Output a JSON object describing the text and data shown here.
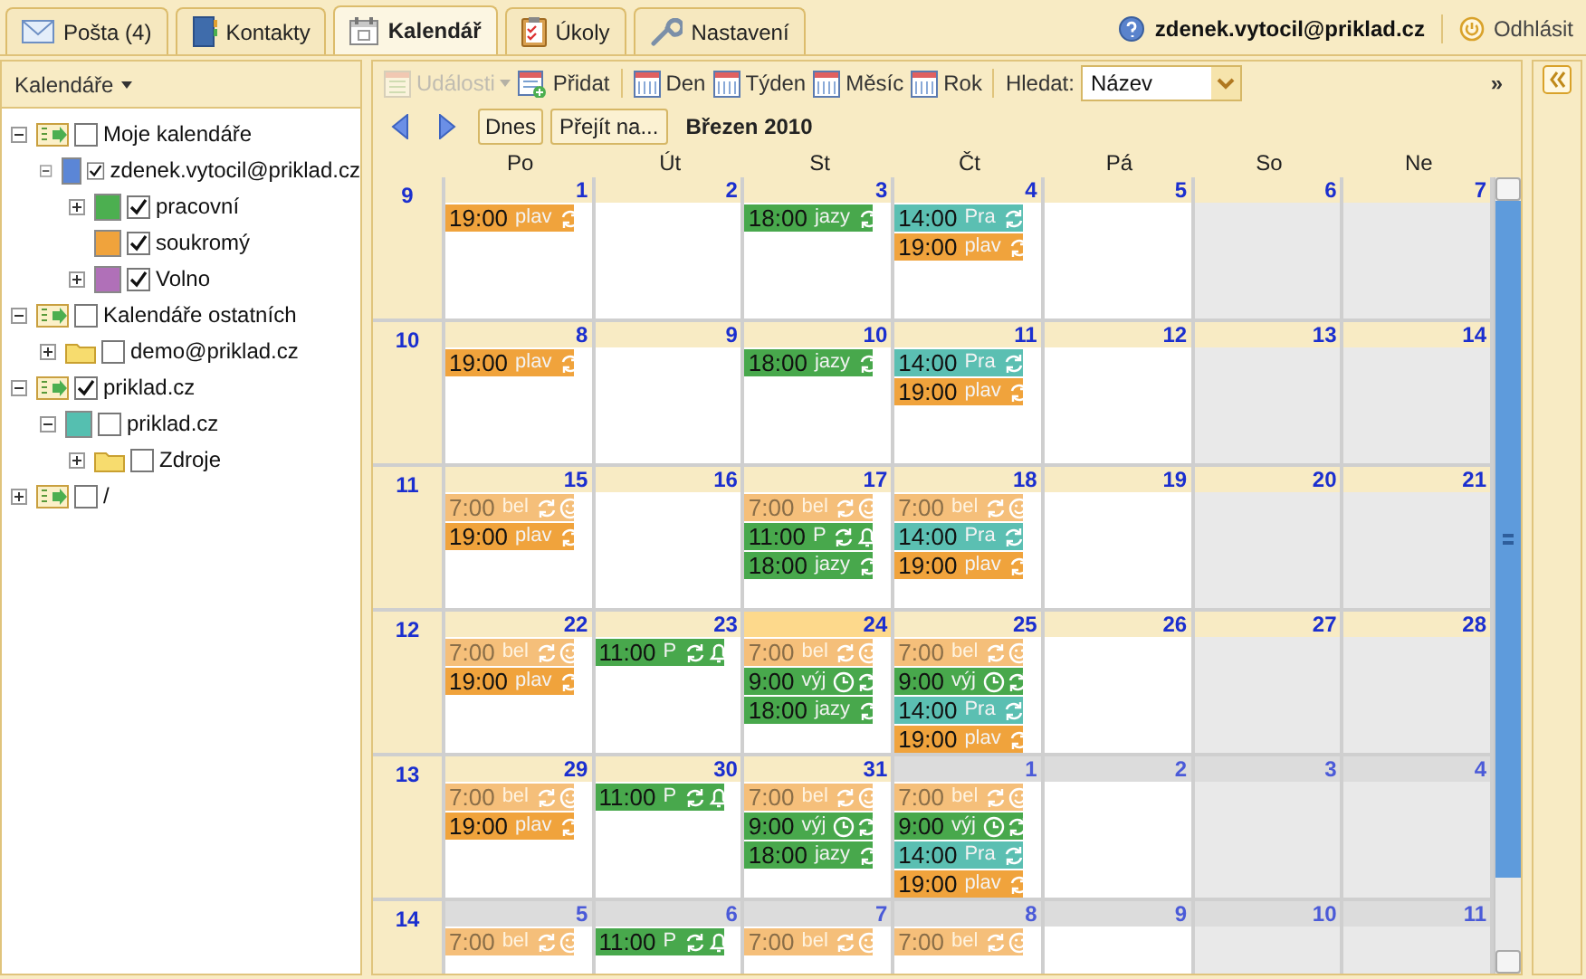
{
  "tabs": [
    {
      "label": "Pošta (4)",
      "kind": "mail",
      "selected": false
    },
    {
      "label": "Kontakty",
      "kind": "contacts",
      "selected": false
    },
    {
      "label": "Kalendář",
      "kind": "calendar",
      "selected": true
    },
    {
      "label": "Úkoly",
      "kind": "tasks",
      "selected": false
    },
    {
      "label": "Nastavení",
      "kind": "settings",
      "selected": false
    }
  ],
  "user": {
    "email": "zdenek.vytocil@priklad.cz",
    "logout": "Odhlásit"
  },
  "sidebar": {
    "title": "Kalendáře",
    "tree": [
      {
        "label": "Moje kalendáře",
        "kind": "group",
        "expanded": true,
        "checked": false,
        "children": [
          {
            "label": "zdenek.vytocil@priklad.cz",
            "kind": "calendar",
            "color": "#5b86d6",
            "expanded": true,
            "checked": true,
            "children": [
              {
                "label": "pracovní",
                "kind": "calendar",
                "color": "#4caf50",
                "expanded": false,
                "checked": true
              },
              {
                "label": "soukromý",
                "kind": "calendar",
                "color": "#f0a33c",
                "checked": true
              },
              {
                "label": "Volno",
                "kind": "calendar",
                "color": "#b070b8",
                "expanded": false,
                "checked": true
              }
            ]
          }
        ]
      },
      {
        "label": "Kalendáře ostatních",
        "kind": "group",
        "expanded": true,
        "checked": false,
        "children": [
          {
            "label": "demo@priklad.cz",
            "kind": "folder",
            "expanded": false,
            "checked": false
          }
        ]
      },
      {
        "label": "priklad.cz",
        "kind": "group",
        "expanded": true,
        "checked": true,
        "children": [
          {
            "label": "priklad.cz",
            "kind": "calendar",
            "color": "#55bfb0",
            "expanded": true,
            "checked": false,
            "children": [
              {
                "label": "Zdroje",
                "kind": "folder",
                "expanded": false,
                "checked": false
              }
            ]
          }
        ]
      },
      {
        "label": "/",
        "kind": "group",
        "expanded": false,
        "checked": false
      }
    ]
  },
  "toolbar": {
    "items": [
      {
        "label": "Události",
        "kind": "menu",
        "disabled": true
      },
      {
        "label": "Přidat",
        "kind": "add",
        "disabled": false
      },
      {
        "label": "Den",
        "kind": "view",
        "disabled": false
      },
      {
        "label": "Týden",
        "kind": "view",
        "disabled": false
      },
      {
        "label": "Měsíc",
        "kind": "view",
        "disabled": false
      },
      {
        "label": "Rok",
        "kind": "view",
        "disabled": false
      }
    ],
    "search_label": "Hledat:",
    "search_value": "Název",
    "more": "»"
  },
  "navigation": {
    "today": "Dnes",
    "goto": "Přejít na...",
    "month": "Březen 2010"
  },
  "weekdays": [
    {
      "label": "Po",
      "weekend": false
    },
    {
      "label": "Út",
      "weekend": false
    },
    {
      "label": "St",
      "weekend": false
    },
    {
      "label": "Čt",
      "weekend": false
    },
    {
      "label": "Pá",
      "weekend": false
    },
    {
      "label": "So",
      "weekend": true
    },
    {
      "label": "Ne",
      "weekend": true
    }
  ],
  "weeks": [
    {
      "number": "9",
      "days": [
        {
          "day": "1",
          "other_month": false,
          "today": false,
          "events": [
            {
              "time": "19:00",
              "title": "plav",
              "color": "#f0a33c",
              "kind": "repeat",
              "tentative": false
            }
          ]
        },
        {
          "day": "2",
          "other_month": false,
          "today": false
        },
        {
          "day": "3",
          "other_month": false,
          "today": false,
          "events": [
            {
              "time": "18:00",
              "title": "jazy",
              "color": "#48a84c",
              "kind": "repeat",
              "tentative": false
            }
          ]
        },
        {
          "day": "4",
          "other_month": false,
          "today": false,
          "events": [
            {
              "time": "14:00",
              "title": "Pra",
              "color": "#5bbfb2",
              "kind": "repeat",
              "tentative": false
            },
            {
              "time": "19:00",
              "title": "plav",
              "color": "#f0a33c",
              "kind": "repeat",
              "tentative": false
            }
          ]
        },
        {
          "day": "5",
          "other_month": false,
          "today": false
        },
        {
          "day": "6",
          "other_month": false,
          "today": false
        },
        {
          "day": "7",
          "other_month": false,
          "today": false
        }
      ]
    },
    {
      "number": "10",
      "days": [
        {
          "day": "8",
          "other_month": false,
          "today": false,
          "events": [
            {
              "time": "19:00",
              "title": "plav",
              "color": "#f0a33c",
              "kind": "repeat",
              "tentative": false
            }
          ]
        },
        {
          "day": "9",
          "other_month": false,
          "today": false
        },
        {
          "day": "10",
          "other_month": false,
          "today": false,
          "events": [
            {
              "time": "18:00",
              "title": "jazy",
              "color": "#48a84c",
              "kind": "repeat",
              "tentative": false
            }
          ]
        },
        {
          "day": "11",
          "other_month": false,
          "today": false,
          "events": [
            {
              "time": "14:00",
              "title": "Pra",
              "color": "#5bbfb2",
              "kind": "repeat",
              "tentative": false
            },
            {
              "time": "19:00",
              "title": "plav",
              "color": "#f0a33c",
              "kind": "repeat",
              "tentative": false
            }
          ]
        },
        {
          "day": "12",
          "other_month": false,
          "today": false
        },
        {
          "day": "13",
          "other_month": false,
          "today": false
        },
        {
          "day": "14",
          "other_month": false,
          "today": false
        }
      ]
    },
    {
      "number": "11",
      "days": [
        {
          "day": "15",
          "other_month": false,
          "today": false,
          "events": [
            {
              "time": "7:00",
              "title": "bel",
              "color": "#f5bf7a",
              "kind": "repeat-mood",
              "tentative": true
            },
            {
              "time": "19:00",
              "title": "plav",
              "color": "#f0a33c",
              "kind": "repeat",
              "tentative": false
            }
          ]
        },
        {
          "day": "16",
          "other_month": false,
          "today": false
        },
        {
          "day": "17",
          "other_month": false,
          "today": false,
          "events": [
            {
              "time": "7:00",
              "title": "bel",
              "color": "#f5bf7a",
              "kind": "repeat-mood",
              "tentative": true
            },
            {
              "time": "11:00",
              "title": "P",
              "color": "#48a84c",
              "kind": "repeat-alarm",
              "tentative": false
            },
            {
              "time": "18:00",
              "title": "jazy",
              "color": "#48a84c",
              "kind": "repeat",
              "tentative": false
            }
          ]
        },
        {
          "day": "18",
          "other_month": false,
          "today": false,
          "events": [
            {
              "time": "7:00",
              "title": "bel",
              "color": "#f5bf7a",
              "kind": "repeat-mood",
              "tentative": true
            },
            {
              "time": "14:00",
              "title": "Pra",
              "color": "#5bbfb2",
              "kind": "repeat",
              "tentative": false
            },
            {
              "time": "19:00",
              "title": "plav",
              "color": "#f0a33c",
              "kind": "repeat",
              "tentative": false
            }
          ]
        },
        {
          "day": "19",
          "other_month": false,
          "today": false
        },
        {
          "day": "20",
          "other_month": false,
          "today": false
        },
        {
          "day": "21",
          "other_month": false,
          "today": false
        }
      ]
    },
    {
      "number": "12",
      "days": [
        {
          "day": "22",
          "other_month": false,
          "today": false,
          "events": [
            {
              "time": "7:00",
              "title": "bel",
              "color": "#f5bf7a",
              "kind": "repeat-mood",
              "tentative": true
            },
            {
              "time": "19:00",
              "title": "plav",
              "color": "#f0a33c",
              "kind": "repeat",
              "tentative": false
            }
          ]
        },
        {
          "day": "23",
          "other_month": false,
          "today": false,
          "events": [
            {
              "time": "11:00",
              "title": "P",
              "color": "#48a84c",
              "kind": "repeat-alarm",
              "tentative": false
            }
          ]
        },
        {
          "day": "24",
          "other_month": false,
          "today": true,
          "events": [
            {
              "time": "7:00",
              "title": "bel",
              "color": "#f5bf7a",
              "kind": "repeat-mood",
              "tentative": true
            },
            {
              "time": "9:00",
              "title": "výj",
              "color": "#48a84c",
              "kind": "clock-repeat",
              "tentative": false
            },
            {
              "time": "18:00",
              "title": "jazy",
              "color": "#48a84c",
              "kind": "repeat",
              "tentative": false
            }
          ]
        },
        {
          "day": "25",
          "other_month": false,
          "today": false,
          "events": [
            {
              "time": "7:00",
              "title": "bel",
              "color": "#f5bf7a",
              "kind": "repeat-mood",
              "tentative": true
            },
            {
              "time": "9:00",
              "title": "výj",
              "color": "#48a84c",
              "kind": "clock-repeat",
              "tentative": false
            },
            {
              "time": "14:00",
              "title": "Pra",
              "color": "#5bbfb2",
              "kind": "repeat",
              "tentative": false
            },
            {
              "time": "19:00",
              "title": "plav",
              "color": "#f0a33c",
              "kind": "repeat",
              "tentative": false
            }
          ]
        },
        {
          "day": "26",
          "other_month": false,
          "today": false
        },
        {
          "day": "27",
          "other_month": false,
          "today": false
        },
        {
          "day": "28",
          "other_month": false,
          "today": false
        }
      ]
    },
    {
      "number": "13",
      "days": [
        {
          "day": "29",
          "other_month": false,
          "today": false,
          "events": [
            {
              "time": "7:00",
              "title": "bel",
              "color": "#f5bf7a",
              "kind": "repeat-mood",
              "tentative": true
            },
            {
              "time": "19:00",
              "title": "plav",
              "color": "#f0a33c",
              "kind": "repeat",
              "tentative": false
            }
          ]
        },
        {
          "day": "30",
          "other_month": false,
          "today": false,
          "events": [
            {
              "time": "11:00",
              "title": "P",
              "color": "#48a84c",
              "kind": "repeat-alarm",
              "tentative": false
            }
          ]
        },
        {
          "day": "31",
          "other_month": false,
          "today": false,
          "events": [
            {
              "time": "7:00",
              "title": "bel",
              "color": "#f5bf7a",
              "kind": "repeat-mood",
              "tentative": true
            },
            {
              "time": "9:00",
              "title": "výj",
              "color": "#48a84c",
              "kind": "clock-repeat",
              "tentative": false
            },
            {
              "time": "18:00",
              "title": "jazy",
              "color": "#48a84c",
              "kind": "repeat",
              "tentative": false
            }
          ]
        },
        {
          "day": "1",
          "other_month": true,
          "today": false,
          "events": [
            {
              "time": "7:00",
              "title": "bel",
              "color": "#f5bf7a",
              "kind": "repeat-mood",
              "tentative": true
            },
            {
              "time": "9:00",
              "title": "výj",
              "color": "#48a84c",
              "kind": "clock-repeat",
              "tentative": false
            },
            {
              "time": "14:00",
              "title": "Pra",
              "color": "#5bbfb2",
              "kind": "repeat",
              "tentative": false
            },
            {
              "time": "19:00",
              "title": "plav",
              "color": "#f0a33c",
              "kind": "repeat",
              "tentative": false
            }
          ]
        },
        {
          "day": "2",
          "other_month": true,
          "today": false
        },
        {
          "day": "3",
          "other_month": true,
          "today": false
        },
        {
          "day": "4",
          "other_month": true,
          "today": false
        }
      ]
    },
    {
      "number": "14",
      "days": [
        {
          "day": "5",
          "other_month": true,
          "today": false,
          "events": [
            {
              "time": "7:00",
              "title": "bel",
              "color": "#f5bf7a",
              "kind": "repeat-mood",
              "tentative": true
            }
          ]
        },
        {
          "day": "6",
          "other_month": true,
          "today": false,
          "events": [
            {
              "time": "11:00",
              "title": "P",
              "color": "#48a84c",
              "kind": "repeat-alarm",
              "tentative": false
            }
          ]
        },
        {
          "day": "7",
          "other_month": true,
          "today": false,
          "events": [
            {
              "time": "7:00",
              "title": "bel",
              "color": "#f5bf7a",
              "kind": "repeat-mood",
              "tentative": true
            }
          ]
        },
        {
          "day": "8",
          "other_month": true,
          "today": false,
          "events": [
            {
              "time": "7:00",
              "title": "bel",
              "color": "#f5bf7a",
              "kind": "repeat-mood",
              "tentative": true
            }
          ]
        },
        {
          "day": "9",
          "other_month": true,
          "today": false
        },
        {
          "day": "10",
          "other_month": true,
          "today": false
        },
        {
          "day": "11",
          "other_month": true,
          "today": false
        }
      ]
    }
  ]
}
